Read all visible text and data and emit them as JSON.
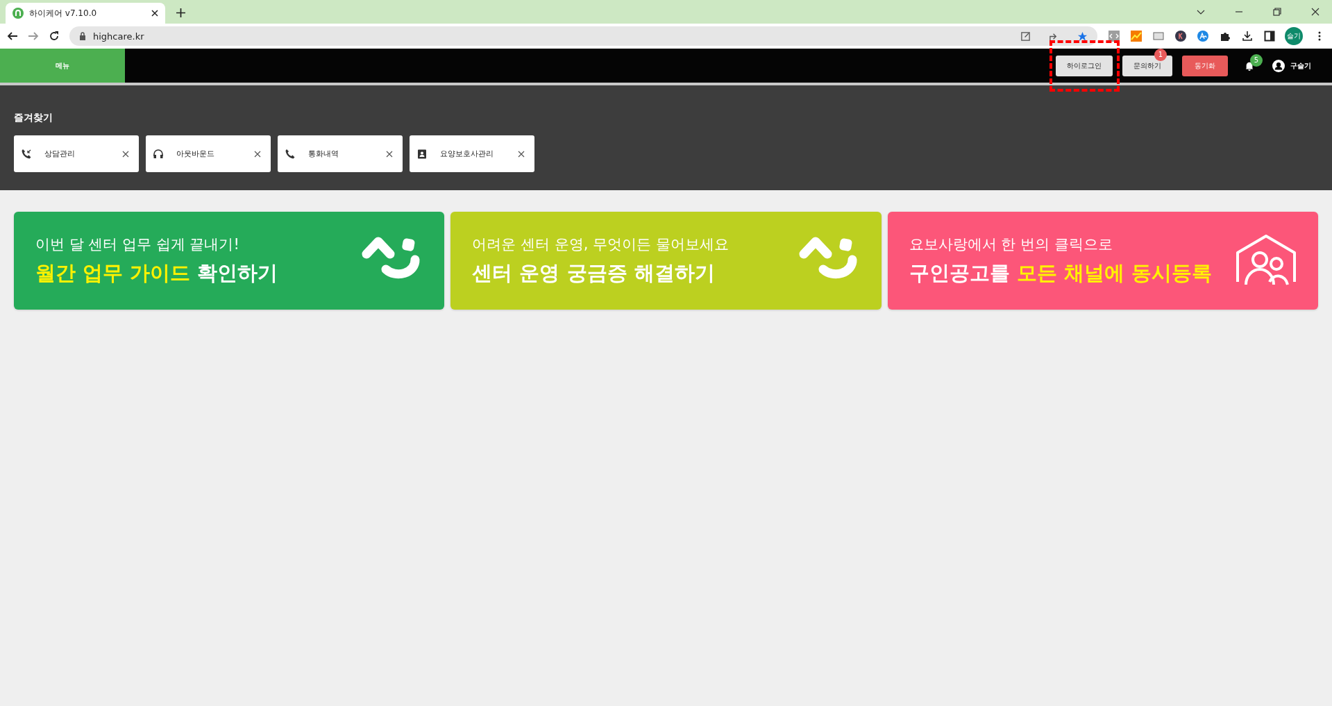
{
  "browser": {
    "tab_title": "하이케어 v7.10.0",
    "url": "highcare.kr",
    "profile": "슬기"
  },
  "header": {
    "menu_label": "메뉴",
    "buttons": [
      {
        "label": "하이로그인",
        "kind": "plain",
        "highlighted": true
      },
      {
        "label": "문의하기",
        "kind": "plain",
        "badge": "1",
        "highlighted": false
      },
      {
        "label": "동기화",
        "kind": "danger",
        "highlighted": false
      }
    ],
    "notifications": {
      "badge": "5"
    },
    "user": {
      "name": "구슬기"
    }
  },
  "favorites": {
    "title": "즐겨찾기",
    "items": [
      {
        "label": "상담관리",
        "kind": "call-transfer"
      },
      {
        "label": "아웃바운드",
        "kind": "headset"
      },
      {
        "label": "통화내역",
        "kind": "phone"
      },
      {
        "label": "요양보호사관리",
        "kind": "badge"
      }
    ]
  },
  "banners": [
    {
      "subtitle": "이번 달 센터 업무 쉽게 끝내기!",
      "color": "#25ab59",
      "kind": "smile",
      "title": [
        {
          "text": "월간 업무 가이드",
          "highlight": true
        },
        {
          "text": " 확인하기",
          "highlight": false
        }
      ]
    },
    {
      "subtitle": "어려운 센터 운영, 무엇이든 물어보세요",
      "color": "#bcd020",
      "kind": "smile",
      "title": [
        {
          "text": "센터 운영 궁금증 해결하기",
          "highlight": false
        }
      ]
    },
    {
      "subtitle": "요보사랑에서 한 번의 클릭으로",
      "color": "#fc5679",
      "kind": "people",
      "title": [
        {
          "text": "구인공고를 ",
          "highlight": false
        },
        {
          "text": "모든 채널에 동시등록",
          "highlight": true
        }
      ]
    }
  ]
}
